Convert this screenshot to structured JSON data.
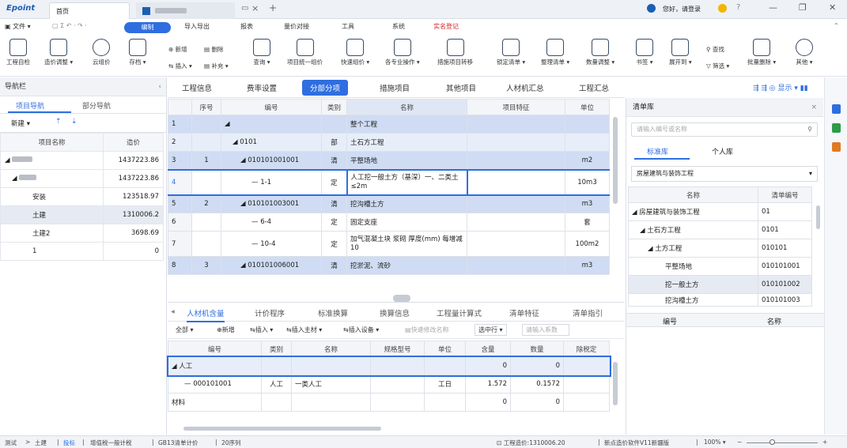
{
  "app": {
    "logo": "Epoint",
    "tab_home": "首页"
  },
  "user": {
    "login": "您好，请登录"
  },
  "menu": [
    "文件",
    "编制",
    "导入导出",
    "报表",
    "量价对接",
    "工具",
    "系统",
    "实名登记"
  ],
  "toolbar": [
    "工程自检",
    "造价调整",
    "云组价",
    "存档",
    "新增",
    "删除",
    "插入",
    "补充",
    "查询",
    "项目统一组价",
    "快速组价",
    "各专业操作",
    "措施项目转移",
    "锁定清单",
    "整理清单",
    "数量调整",
    "书签",
    "展开到",
    "查找",
    "筛选",
    "批量删除",
    "其他"
  ],
  "nav": {
    "title": "导航栏",
    "tab1": "项目导航",
    "tab2": "部分导航",
    "new_label": "新建",
    "col_name": "项目名称",
    "col_price": "造价",
    "rows": [
      {
        "name": "",
        "price": "1437223.86"
      },
      {
        "name": "",
        "price": "1437223.86"
      },
      {
        "name": "安装",
        "price": "123518.97"
      },
      {
        "name": "土建",
        "price": "1310006.2"
      },
      {
        "name": "土建2",
        "price": "3698.69"
      },
      {
        "name": "1",
        "price": "0"
      }
    ]
  },
  "ptabs": [
    "工程信息",
    "费率设置",
    "分部分项",
    "措施项目",
    "其他项目",
    "人材机汇总",
    "工程汇总"
  ],
  "ptab_right": "显示",
  "grid": {
    "headers": [
      "序号",
      "编号",
      "类别",
      "名称",
      "项目特征",
      "单位"
    ],
    "rows": [
      {
        "n": "1",
        "seq": "",
        "code": "",
        "type": "",
        "name": "整个工程",
        "feat": "",
        "unit": ""
      },
      {
        "n": "2",
        "seq": "",
        "code": "0101",
        "type": "部",
        "name": "土石方工程",
        "feat": "",
        "unit": ""
      },
      {
        "n": "3",
        "seq": "1",
        "code": "010101001001",
        "type": "清",
        "name": "平整场地",
        "feat": "",
        "unit": "m2"
      },
      {
        "n": "4",
        "seq": "",
        "code": "1-1",
        "type": "定",
        "name": "人工挖一般土方（基深）一、二类土 ≤2m",
        "feat": "",
        "unit": "10m3"
      },
      {
        "n": "5",
        "seq": "2",
        "code": "010101003001",
        "type": "清",
        "name": "挖沟槽土方",
        "feat": "",
        "unit": "m3"
      },
      {
        "n": "6",
        "seq": "",
        "code": "6-4",
        "type": "定",
        "name": "固定支座",
        "feat": "",
        "unit": "套"
      },
      {
        "n": "7",
        "seq": "",
        "code": "10-4",
        "type": "定",
        "name": "加气混凝土块 浆砌 厚度(mm) 每增减10",
        "feat": "",
        "unit": "100m2"
      },
      {
        "n": "8",
        "seq": "3",
        "code": "010101006001",
        "type": "清",
        "name": "挖淤泥、流砂",
        "feat": "",
        "unit": "m3"
      }
    ]
  },
  "btabs": [
    "人材机含量",
    "计价程序",
    "标准换算",
    "换算信息",
    "工程量计算式",
    "清单特征",
    "清单指引"
  ],
  "btool": [
    "全部",
    "新增",
    "插入",
    "插入主材",
    "插入设备",
    "快速修改名称",
    "选中行",
    "请输入系数"
  ],
  "bgrid": {
    "headers": [
      "编号",
      "类别",
      "名称",
      "规格型号",
      "单位",
      "含量",
      "数量",
      "除税定"
    ],
    "rows": [
      {
        "code": "人工",
        "type": "",
        "name": "",
        "spec": "",
        "unit": "",
        "qty": "0",
        "num": "0"
      },
      {
        "code": "000101001",
        "type": "人工",
        "name": "一类人工",
        "spec": "",
        "unit": "工日",
        "qty": "1.572",
        "num": "0.1572"
      },
      {
        "code": "材料",
        "type": "",
        "name": "",
        "spec": "",
        "unit": "",
        "qty": "0",
        "num": "0"
      }
    ]
  },
  "right": {
    "title": "清单库",
    "placeholder": "请输入编号或名称",
    "tab1": "标准库",
    "tab2": "个人库",
    "lib": "房屋建筑与装饰工程",
    "col_name": "名称",
    "col_code": "清单编号",
    "rows": [
      {
        "name": "房屋建筑与装饰工程",
        "code": "01"
      },
      {
        "name": "土石方工程",
        "code": "0101"
      },
      {
        "name": "土方工程",
        "code": "010101"
      },
      {
        "name": "平整场地",
        "code": "010101001"
      },
      {
        "name": "挖一般土方",
        "code": "010101002"
      },
      {
        "name": "挖沟槽土方",
        "code": "010101003"
      }
    ],
    "sub_col1": "编号",
    "sub_col2": "名称"
  },
  "status": {
    "s1": "测试",
    "s2": "土建",
    "s3": "投标",
    "s4": "增值税一般计税",
    "s5": "GB13清单计价",
    "s6": "20序列",
    "cost": "工程造价:1310006.20",
    "version": "新点造价软件V11新疆版",
    "zoom": "100%"
  }
}
